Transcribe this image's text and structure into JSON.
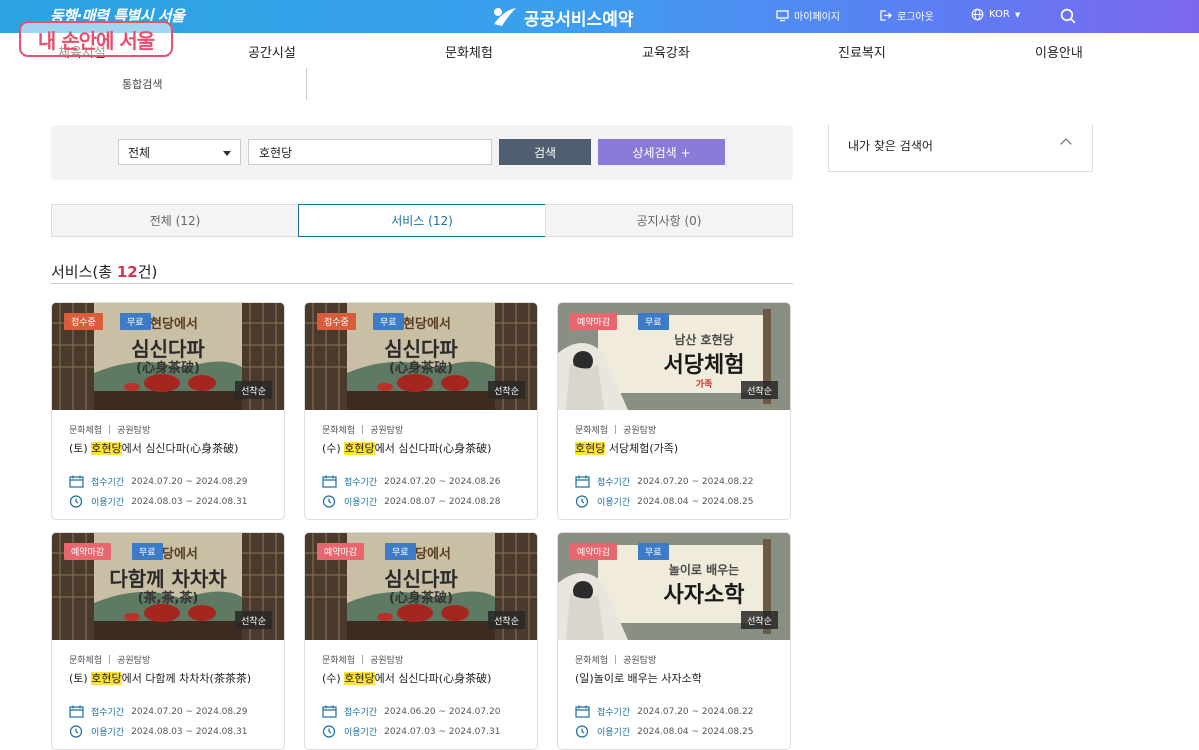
{
  "header": {
    "slogan": "동행·매력 특별시 서울",
    "brand": "공공서비스예약",
    "mypage": "마이페이지",
    "logout": "로그아웃",
    "language": "KOR"
  },
  "overlay_badge": "내 손안에 서울",
  "gnb": {
    "items": [
      {
        "label": "체육시설"
      },
      {
        "label": "공간시설"
      },
      {
        "label": "문화체험"
      },
      {
        "label": "교육강좌"
      },
      {
        "label": "진료복지"
      },
      {
        "label": "이용안내"
      }
    ],
    "sub_item": "통합검색"
  },
  "search": {
    "category": "전체",
    "query": "호현당",
    "search_button": "검색",
    "detail_button": "상세검색 +"
  },
  "recent": {
    "title": "내가 찾은 검색어"
  },
  "tabs": [
    {
      "label": "전체 (12)",
      "active": false
    },
    {
      "label": "서비스 (12)",
      "active": true
    },
    {
      "label": "공지사항 (0)",
      "active": false
    }
  ],
  "section": {
    "prefix": "서비스(총 ",
    "count": "12",
    "suffix": "건)"
  },
  "colors": {
    "accent": "#1a6f9e",
    "highlight": "#ffe236",
    "count": "#d3344a"
  },
  "cards": [
    {
      "status": "접수중",
      "fee": "무료",
      "sort": "선착순",
      "thumb_title": "심신다파",
      "thumb_sub": "(心身茶破)",
      "thumb_top": "호현당에서",
      "category": "문화체험",
      "place": "공원탐방",
      "title_pre": "(토) ",
      "title_hl": "호현당",
      "title_post": "에서 심신다파(心身茶破)",
      "apply_label": "접수기간",
      "apply": "2024.07.20 ~ 2024.08.29",
      "use_label": "이용기간",
      "use": "2024.08.03 ~ 2024.08.31"
    },
    {
      "status": "접수중",
      "fee": "무료",
      "sort": "선착순",
      "thumb_title": "심신다파",
      "thumb_sub": "(心身茶破)",
      "thumb_top": "호현당에서",
      "category": "문화체험",
      "place": "공원탐방",
      "title_pre": "(수) ",
      "title_hl": "호현당",
      "title_post": "에서 심신다파(心身茶破)",
      "apply_label": "접수기간",
      "apply": "2024.07.20 ~ 2024.08.26",
      "use_label": "이용기간",
      "use": "2024.08.07 ~ 2024.08.28"
    },
    {
      "status": "예약마감",
      "fee": "무료",
      "sort": "선착순",
      "thumb_title": "서당체험",
      "thumb_sub": "가족",
      "thumb_top": "남산 호현당",
      "category": "문화체험",
      "place": "공원탐방",
      "title_pre": "",
      "title_hl": "호현당",
      "title_post": " 서당체험(가족)",
      "apply_label": "접수기간",
      "apply": "2024.07.20 ~ 2024.08.22",
      "use_label": "이용기간",
      "use": "2024.08.04 ~ 2024.08.25"
    },
    {
      "status": "예약마감",
      "fee": "무료",
      "sort": "선착순",
      "thumb_title": "다함께 차차차",
      "thumb_sub": "(茶,茶,茶)",
      "thumb_top": "호현당에서",
      "category": "문화체험",
      "place": "공원탐방",
      "title_pre": "(토) ",
      "title_hl": "호현당",
      "title_post": "에서 다함께 차차차(茶茶茶)",
      "apply_label": "접수기간",
      "apply": "2024.07.20 ~ 2024.08.29",
      "use_label": "이용기간",
      "use": "2024.08.03 ~ 2024.08.31"
    },
    {
      "status": "예약마감",
      "fee": "무료",
      "sort": "선착순",
      "thumb_title": "심신다파",
      "thumb_sub": "(心身茶破)",
      "thumb_top": "호현당에서",
      "category": "문화체험",
      "place": "공원탐방",
      "title_pre": "(수) ",
      "title_hl": "호현당",
      "title_post": "에서 심신다파(心身茶破)",
      "apply_label": "접수기간",
      "apply": "2024.06.20 ~ 2024.07.20",
      "use_label": "이용기간",
      "use": "2024.07.03 ~ 2024.07.31"
    },
    {
      "status": "예약마감",
      "fee": "무료",
      "sort": "선착순",
      "thumb_title": "사자소학",
      "thumb_sub": "",
      "thumb_top": "놀이로 배우는",
      "category": "문화체험",
      "place": "공원탐방",
      "title_pre": "(일)놀이로 배우는 사자소학",
      "title_hl": "",
      "title_post": "",
      "apply_label": "접수기간",
      "apply": "2024.07.20 ~ 2024.08.22",
      "use_label": "이용기간",
      "use": "2024.08.04 ~ 2024.08.25"
    }
  ]
}
